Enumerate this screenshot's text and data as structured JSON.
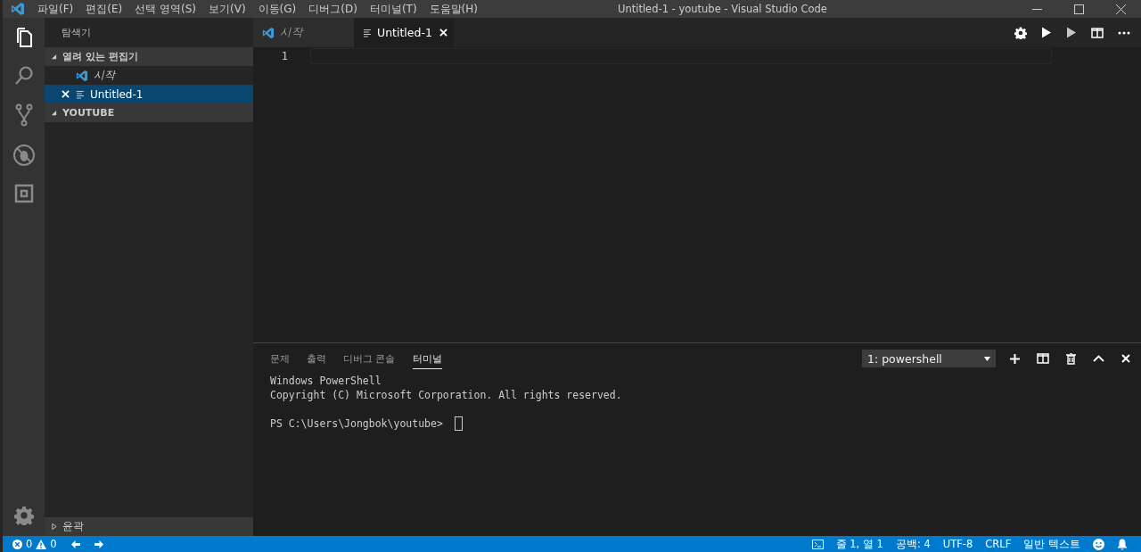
{
  "window": {
    "title": "Untitled-1 - youtube - Visual Studio Code"
  },
  "menubar": [
    "파일(F)",
    "편집(E)",
    "선택 영역(S)",
    "보기(V)",
    "이동(G)",
    "디버그(D)",
    "터미널(T)",
    "도움말(H)"
  ],
  "activity_bar": [
    {
      "kind": "files",
      "selected": true
    },
    {
      "kind": "search",
      "selected": false
    },
    {
      "kind": "source-control",
      "selected": false
    },
    {
      "kind": "debug",
      "selected": false
    },
    {
      "kind": "extensions",
      "selected": false
    }
  ],
  "sidebar": {
    "title": "탐색기",
    "sections": [
      {
        "label": "열려 있는 편집기",
        "expanded": true,
        "items": [
          {
            "kind": "start",
            "label": "시작",
            "selected": false
          },
          {
            "kind": "file",
            "label": "Untitled-1",
            "selected": true
          }
        ]
      },
      {
        "label": "YOUTUBE",
        "expanded": true
      }
    ],
    "footer": {
      "label": "윤곽",
      "expanded": false
    }
  },
  "tabs": [
    {
      "kind": "start",
      "label": "시작",
      "selected": false
    },
    {
      "kind": "file",
      "label": "Untitled-1",
      "selected": true
    }
  ],
  "editor": {
    "line_numbers": [
      "1"
    ]
  },
  "panel": {
    "tabs": [
      {
        "label": "문제",
        "selected": false
      },
      {
        "label": "출력",
        "selected": false
      },
      {
        "label": "디버그 콘솔",
        "selected": false
      },
      {
        "label": "터미널",
        "selected": true
      }
    ],
    "terminal_select": "1: powershell",
    "banner": [
      "Windows PowerShell",
      "Copyright (C) Microsoft Corporation. All rights reserved."
    ],
    "prompt": "PS C:\\Users\\Jongbok\\youtube>"
  },
  "status_bar": {
    "errors": "0",
    "warnings": "0",
    "position": "줄 1, 열 1",
    "indent": "공백: 4",
    "encoding": "UTF-8",
    "eol": "CRLF",
    "language": "일반 텍스트"
  }
}
